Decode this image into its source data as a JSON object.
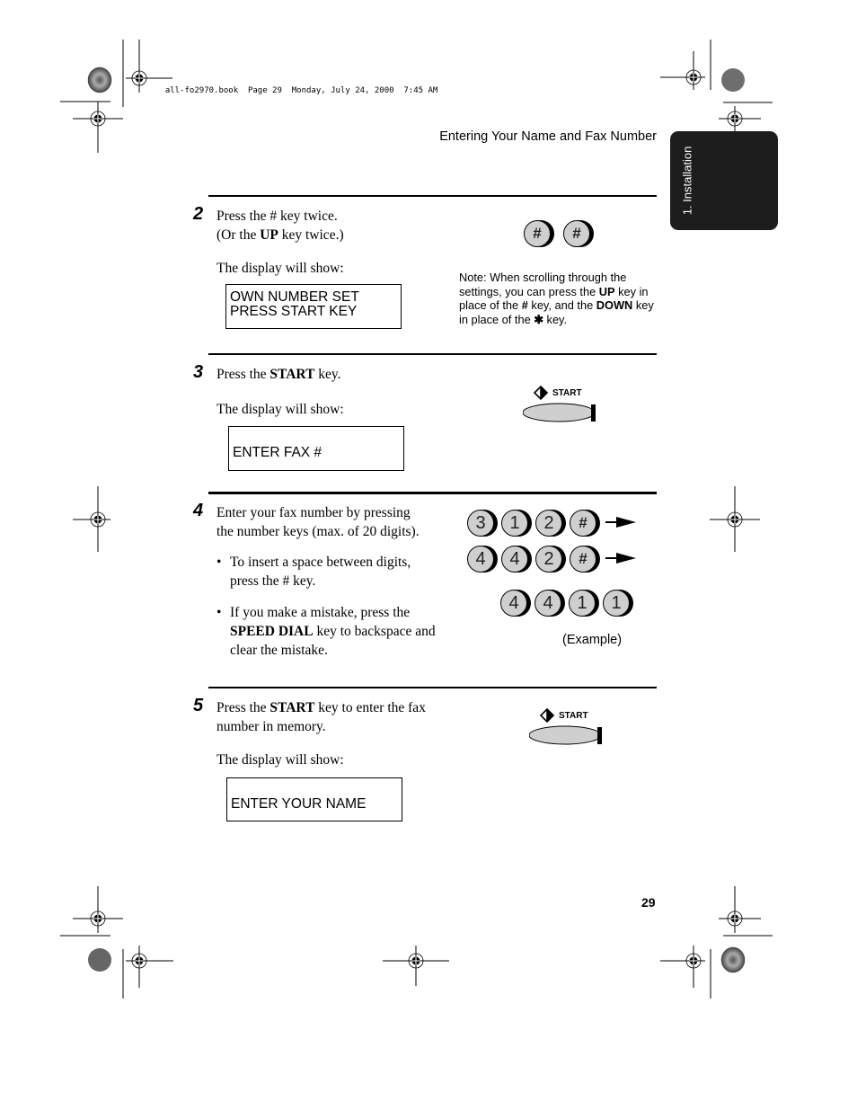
{
  "slug": {
    "file": "all-fo2970.book",
    "page": "Page 29",
    "date": "Monday, July 24, 2000",
    "time": "7:45 AM"
  },
  "header": {
    "running_head": "Entering Your Name and Fax Number",
    "chapter_tab": "1. Installation"
  },
  "steps": [
    {
      "number": "2",
      "lines": [
        "Press the # key twice.",
        "(Or the ",
        "UP",
        " key twice.)"
      ],
      "display_intro": "The display will show:",
      "display_lines": [
        "OWN NUMBER SET",
        "PRESS START KEY"
      ],
      "keys": [
        "#",
        "#"
      ]
    },
    {
      "number": "3",
      "text_pre": "Press the ",
      "text_bold": "START",
      "text_post": " key.",
      "display_intro": "The display will show:",
      "display_lines": [
        "ENTER FAX #"
      ],
      "key_label": "START"
    },
    {
      "number": "4",
      "text_line1": "Enter your fax number by pressing",
      "text_line2": "the number keys (max. of 20 digits).",
      "bullets": [
        {
          "line1": "To insert  a space between digits,",
          "line2": "press the # key."
        },
        {
          "line1": "If you make a mistake, press the",
          "line2_bold": "SPEED DIAL",
          "line2_post": " key to backspace and",
          "line3": "clear the mistake."
        }
      ],
      "example_keys": [
        [
          "3",
          "1",
          "2",
          "#"
        ],
        [
          "4",
          "4",
          "2",
          "#"
        ],
        [
          "4",
          "4",
          "1",
          "1"
        ]
      ],
      "example_label": "(Example)"
    },
    {
      "number": "5",
      "text_pre": "Press the ",
      "text_bold": "START",
      "text_post": " key to enter the fax",
      "text_line2": "number in memory.",
      "display_intro": "The display will show:",
      "display_lines": [
        "ENTER YOUR NAME"
      ],
      "key_label": "START"
    }
  ],
  "note": {
    "p1": "Note: When scrolling through the settings, you can press the ",
    "b1": "UP",
    "p2": " key in place of the ",
    "b2": "#",
    "p3": " key, and the ",
    "b3": "DOWN",
    "p4": " key in place of the ",
    "symbol": "✱",
    "p5": " key."
  },
  "footer": {
    "page_number": "29"
  }
}
